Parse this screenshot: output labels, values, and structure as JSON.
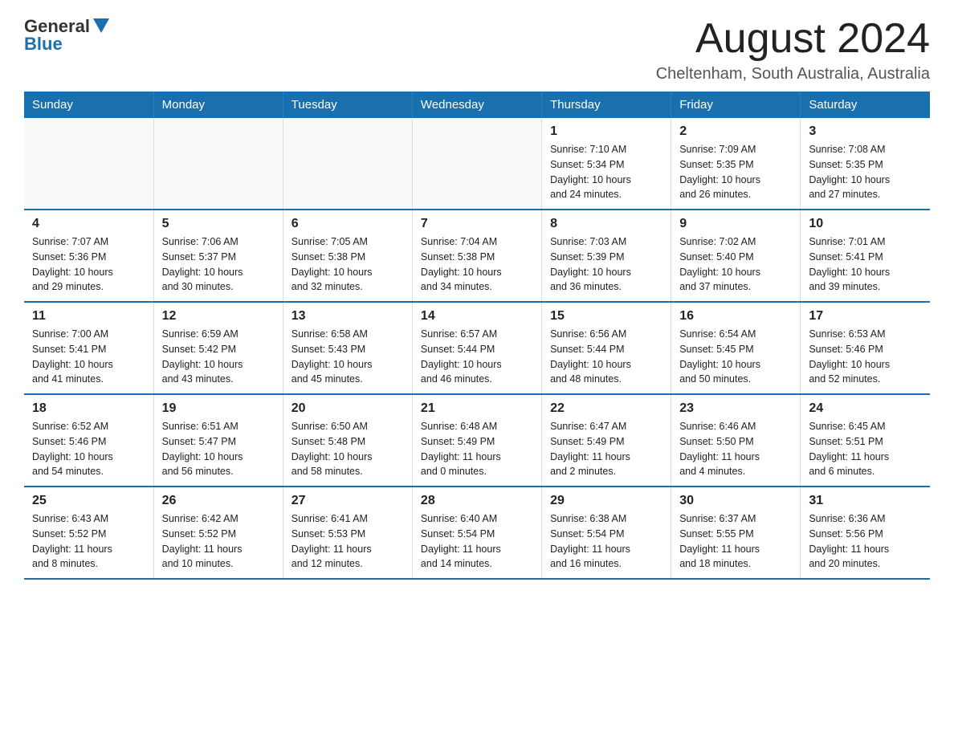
{
  "logo": {
    "general": "General",
    "blue": "Blue"
  },
  "title": "August 2024",
  "subtitle": "Cheltenham, South Australia, Australia",
  "days_of_week": [
    "Sunday",
    "Monday",
    "Tuesday",
    "Wednesday",
    "Thursday",
    "Friday",
    "Saturday"
  ],
  "weeks": [
    [
      {
        "day": "",
        "info": ""
      },
      {
        "day": "",
        "info": ""
      },
      {
        "day": "",
        "info": ""
      },
      {
        "day": "",
        "info": ""
      },
      {
        "day": "1",
        "info": "Sunrise: 7:10 AM\nSunset: 5:34 PM\nDaylight: 10 hours\nand 24 minutes."
      },
      {
        "day": "2",
        "info": "Sunrise: 7:09 AM\nSunset: 5:35 PM\nDaylight: 10 hours\nand 26 minutes."
      },
      {
        "day": "3",
        "info": "Sunrise: 7:08 AM\nSunset: 5:35 PM\nDaylight: 10 hours\nand 27 minutes."
      }
    ],
    [
      {
        "day": "4",
        "info": "Sunrise: 7:07 AM\nSunset: 5:36 PM\nDaylight: 10 hours\nand 29 minutes."
      },
      {
        "day": "5",
        "info": "Sunrise: 7:06 AM\nSunset: 5:37 PM\nDaylight: 10 hours\nand 30 minutes."
      },
      {
        "day": "6",
        "info": "Sunrise: 7:05 AM\nSunset: 5:38 PM\nDaylight: 10 hours\nand 32 minutes."
      },
      {
        "day": "7",
        "info": "Sunrise: 7:04 AM\nSunset: 5:38 PM\nDaylight: 10 hours\nand 34 minutes."
      },
      {
        "day": "8",
        "info": "Sunrise: 7:03 AM\nSunset: 5:39 PM\nDaylight: 10 hours\nand 36 minutes."
      },
      {
        "day": "9",
        "info": "Sunrise: 7:02 AM\nSunset: 5:40 PM\nDaylight: 10 hours\nand 37 minutes."
      },
      {
        "day": "10",
        "info": "Sunrise: 7:01 AM\nSunset: 5:41 PM\nDaylight: 10 hours\nand 39 minutes."
      }
    ],
    [
      {
        "day": "11",
        "info": "Sunrise: 7:00 AM\nSunset: 5:41 PM\nDaylight: 10 hours\nand 41 minutes."
      },
      {
        "day": "12",
        "info": "Sunrise: 6:59 AM\nSunset: 5:42 PM\nDaylight: 10 hours\nand 43 minutes."
      },
      {
        "day": "13",
        "info": "Sunrise: 6:58 AM\nSunset: 5:43 PM\nDaylight: 10 hours\nand 45 minutes."
      },
      {
        "day": "14",
        "info": "Sunrise: 6:57 AM\nSunset: 5:44 PM\nDaylight: 10 hours\nand 46 minutes."
      },
      {
        "day": "15",
        "info": "Sunrise: 6:56 AM\nSunset: 5:44 PM\nDaylight: 10 hours\nand 48 minutes."
      },
      {
        "day": "16",
        "info": "Sunrise: 6:54 AM\nSunset: 5:45 PM\nDaylight: 10 hours\nand 50 minutes."
      },
      {
        "day": "17",
        "info": "Sunrise: 6:53 AM\nSunset: 5:46 PM\nDaylight: 10 hours\nand 52 minutes."
      }
    ],
    [
      {
        "day": "18",
        "info": "Sunrise: 6:52 AM\nSunset: 5:46 PM\nDaylight: 10 hours\nand 54 minutes."
      },
      {
        "day": "19",
        "info": "Sunrise: 6:51 AM\nSunset: 5:47 PM\nDaylight: 10 hours\nand 56 minutes."
      },
      {
        "day": "20",
        "info": "Sunrise: 6:50 AM\nSunset: 5:48 PM\nDaylight: 10 hours\nand 58 minutes."
      },
      {
        "day": "21",
        "info": "Sunrise: 6:48 AM\nSunset: 5:49 PM\nDaylight: 11 hours\nand 0 minutes."
      },
      {
        "day": "22",
        "info": "Sunrise: 6:47 AM\nSunset: 5:49 PM\nDaylight: 11 hours\nand 2 minutes."
      },
      {
        "day": "23",
        "info": "Sunrise: 6:46 AM\nSunset: 5:50 PM\nDaylight: 11 hours\nand 4 minutes."
      },
      {
        "day": "24",
        "info": "Sunrise: 6:45 AM\nSunset: 5:51 PM\nDaylight: 11 hours\nand 6 minutes."
      }
    ],
    [
      {
        "day": "25",
        "info": "Sunrise: 6:43 AM\nSunset: 5:52 PM\nDaylight: 11 hours\nand 8 minutes."
      },
      {
        "day": "26",
        "info": "Sunrise: 6:42 AM\nSunset: 5:52 PM\nDaylight: 11 hours\nand 10 minutes."
      },
      {
        "day": "27",
        "info": "Sunrise: 6:41 AM\nSunset: 5:53 PM\nDaylight: 11 hours\nand 12 minutes."
      },
      {
        "day": "28",
        "info": "Sunrise: 6:40 AM\nSunset: 5:54 PM\nDaylight: 11 hours\nand 14 minutes."
      },
      {
        "day": "29",
        "info": "Sunrise: 6:38 AM\nSunset: 5:54 PM\nDaylight: 11 hours\nand 16 minutes."
      },
      {
        "day": "30",
        "info": "Sunrise: 6:37 AM\nSunset: 5:55 PM\nDaylight: 11 hours\nand 18 minutes."
      },
      {
        "day": "31",
        "info": "Sunrise: 6:36 AM\nSunset: 5:56 PM\nDaylight: 11 hours\nand 20 minutes."
      }
    ]
  ]
}
